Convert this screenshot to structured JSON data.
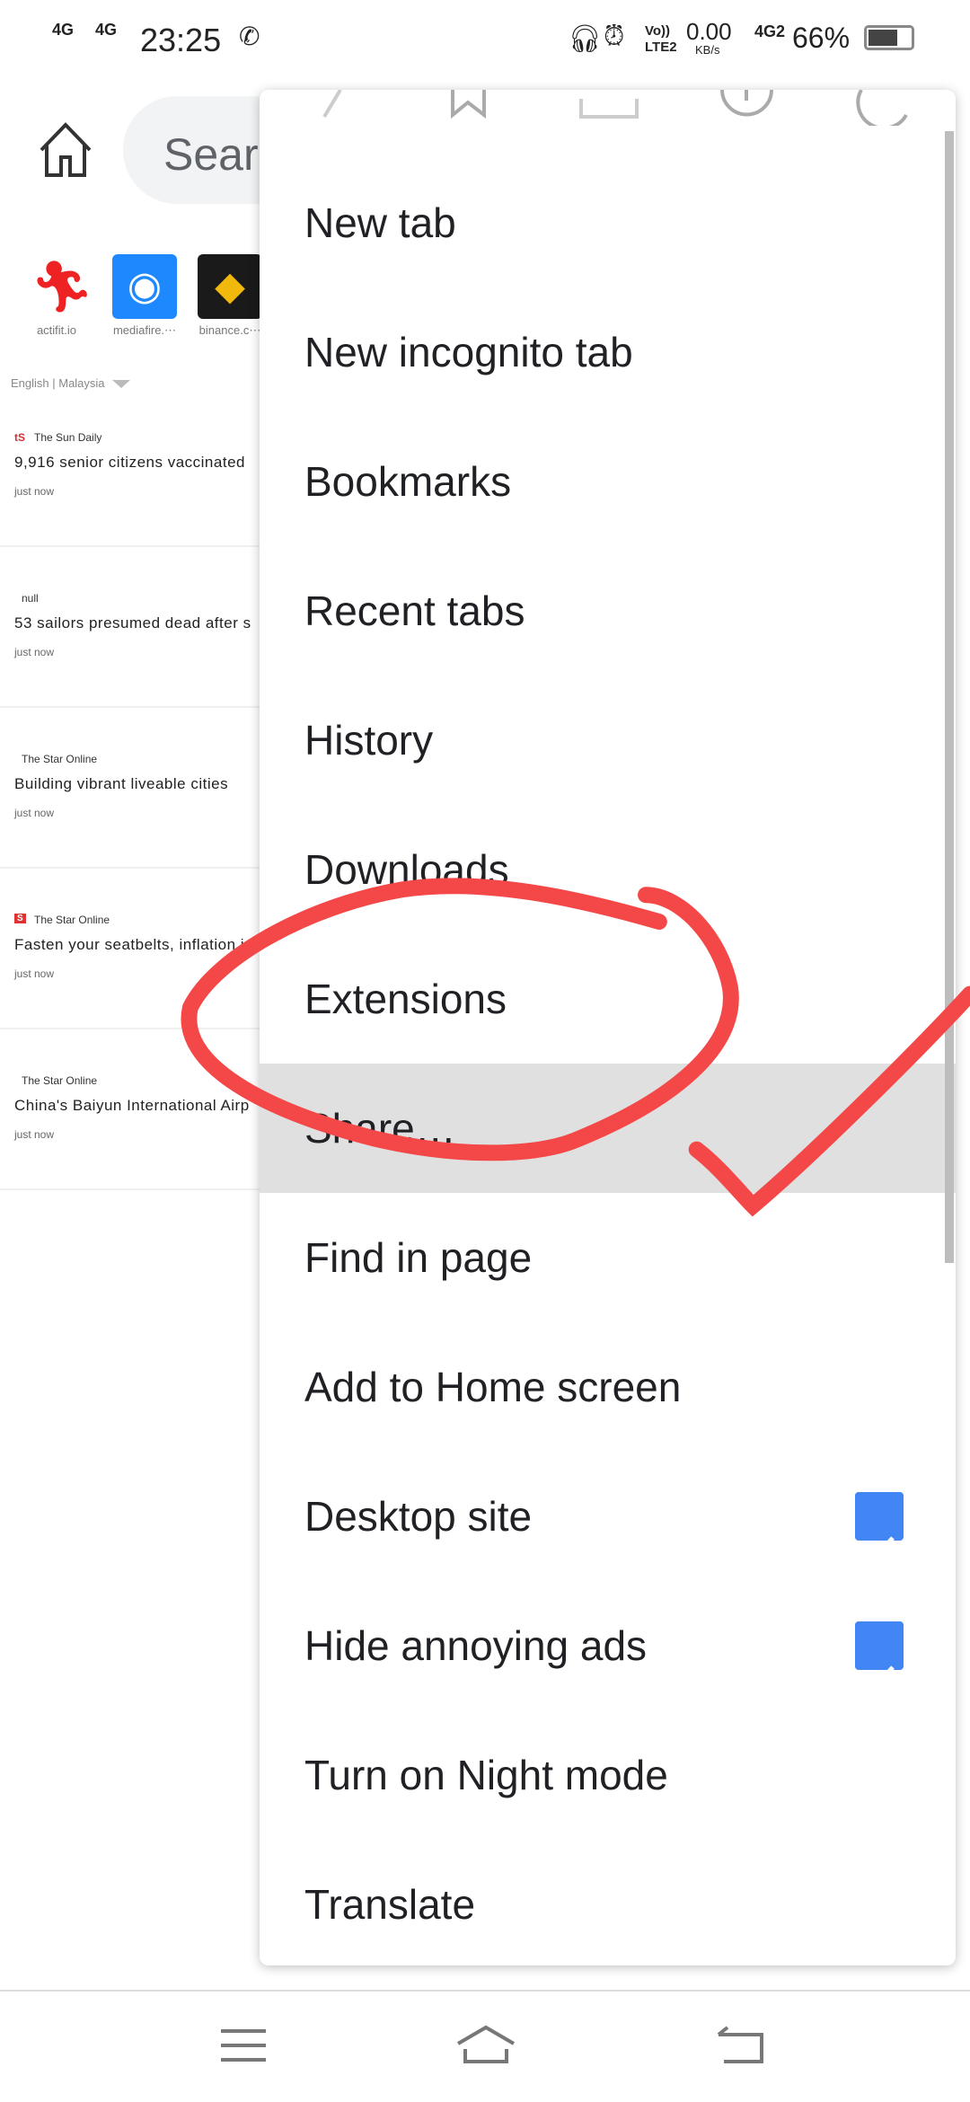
{
  "status_bar": {
    "network1": "4G",
    "network2": "4G",
    "time": "23:25",
    "volte": "Vo)) LTE2",
    "speed": "0.00",
    "speed_unit": "KB/s",
    "network3": "4G2",
    "battery": "66%"
  },
  "toolbar": {
    "search_placeholder": "Search"
  },
  "shortcuts": [
    {
      "label": "actifit.io"
    },
    {
      "label": "mediafire.⋯"
    },
    {
      "label": "binance.c⋯"
    }
  ],
  "feed": {
    "language": "English | Malaysia",
    "items": [
      {
        "source": "The Sun Daily",
        "title": "9,916 senior citizens vaccinated",
        "time": "just now"
      },
      {
        "source": "null",
        "title": "53 sailors presumed dead after s",
        "time": "just now"
      },
      {
        "source": "The Star Online",
        "title": "Building vibrant liveable cities",
        "time": "just now"
      },
      {
        "source": "The Star Online",
        "title": "Fasten your seatbelts, inflation is",
        "time": "just now"
      },
      {
        "source": "The Star Online",
        "title": "China's Baiyun International Airp",
        "time": "just now"
      }
    ]
  },
  "menu": {
    "items": [
      {
        "label": "New tab"
      },
      {
        "label": "New incognito tab"
      },
      {
        "label": "Bookmarks"
      },
      {
        "label": "Recent tabs"
      },
      {
        "label": "History"
      },
      {
        "label": "Downloads"
      },
      {
        "label": "Extensions"
      },
      {
        "label": "Share…",
        "highlighted": true
      },
      {
        "label": "Find in page"
      },
      {
        "label": "Add to Home screen"
      },
      {
        "label": "Desktop site",
        "checked": true
      },
      {
        "label": "Hide annoying ads",
        "checked": true
      },
      {
        "label": "Turn on Night mode"
      },
      {
        "label": "Translate"
      }
    ]
  },
  "colors": {
    "accent": "#4285f4",
    "annotation": "#f44848",
    "highlight": "#e0e0e0"
  }
}
